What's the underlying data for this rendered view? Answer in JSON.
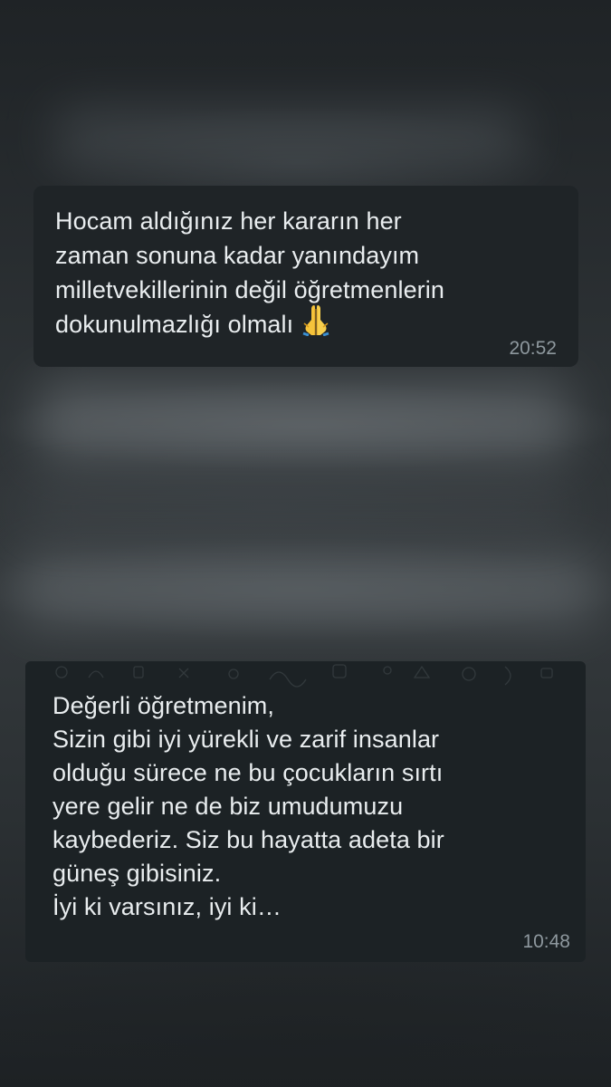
{
  "messages": [
    {
      "text": "Hocam aldığınız her kararın her\nzaman sonuna kadar yanındayım\nmilletvekillerinin değil öğretmenlerin\ndokunulmazlığı olmalı",
      "emoji": "folded-hands-icon",
      "time": "20:52"
    },
    {
      "text": "Değerli öğretmenim,\nSizin gibi iyi yürekli ve zarif insanlar\nolduğu sürece ne bu çocukların sırtı\nyere gelir ne de biz umudumuzu\nkaybederiz. Siz bu hayatta adeta bir\ngüneş gibisiniz.\nİyi ki varsınız, iyi ki…",
      "time": "10:48"
    }
  ],
  "colors": {
    "bubble": "#1e2428",
    "text": "#e9edef",
    "timestamp": "#8e989e",
    "background": "#2a2e31"
  }
}
